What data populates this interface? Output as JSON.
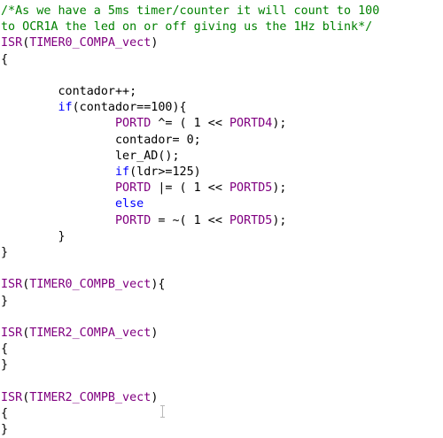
{
  "editor": {
    "colors": {
      "comment": "#008000",
      "macro": "#800080",
      "keyword": "#0000ff",
      "plain": "#000000",
      "background": "#ffffff"
    },
    "lines": [
      [
        {
          "t": "/*As we have a 5ms timer/counter it will count to 100",
          "c": "comment"
        }
      ],
      [
        {
          "t": "to OCR1A the led on or off giving us the 1Hz blink*/",
          "c": "comment"
        }
      ],
      [
        {
          "t": "ISR",
          "c": "macro"
        },
        {
          "t": "(",
          "c": "plain"
        },
        {
          "t": "TIMER0_COMPA_vect",
          "c": "macro"
        },
        {
          "t": ")",
          "c": "plain"
        }
      ],
      [
        {
          "t": "{",
          "c": "plain"
        }
      ],
      [
        {
          "t": "",
          "c": "plain"
        }
      ],
      [
        {
          "t": "        contador++;",
          "c": "plain"
        }
      ],
      [
        {
          "t": "        ",
          "c": "plain"
        },
        {
          "t": "if",
          "c": "keyword"
        },
        {
          "t": "(contador==100){",
          "c": "plain"
        }
      ],
      [
        {
          "t": "                ",
          "c": "plain"
        },
        {
          "t": "PORTD",
          "c": "macro"
        },
        {
          "t": " ^= ( 1 << ",
          "c": "plain"
        },
        {
          "t": "PORTD4",
          "c": "macro"
        },
        {
          "t": ");",
          "c": "plain"
        }
      ],
      [
        {
          "t": "                contador= 0;",
          "c": "plain"
        }
      ],
      [
        {
          "t": "                ler_AD();",
          "c": "plain"
        }
      ],
      [
        {
          "t": "                ",
          "c": "plain"
        },
        {
          "t": "if",
          "c": "keyword"
        },
        {
          "t": "(ldr>=125)",
          "c": "plain"
        }
      ],
      [
        {
          "t": "                ",
          "c": "plain"
        },
        {
          "t": "PORTD",
          "c": "macro"
        },
        {
          "t": " |= ( 1 << ",
          "c": "plain"
        },
        {
          "t": "PORTD5",
          "c": "macro"
        },
        {
          "t": ");",
          "c": "plain"
        }
      ],
      [
        {
          "t": "                ",
          "c": "plain"
        },
        {
          "t": "else",
          "c": "keyword"
        }
      ],
      [
        {
          "t": "                ",
          "c": "plain"
        },
        {
          "t": "PORTD",
          "c": "macro"
        },
        {
          "t": " = ~( 1 << ",
          "c": "plain"
        },
        {
          "t": "PORTD5",
          "c": "macro"
        },
        {
          "t": ");",
          "c": "plain"
        }
      ],
      [
        {
          "t": "        }",
          "c": "plain"
        }
      ],
      [
        {
          "t": "}",
          "c": "plain"
        }
      ],
      [
        {
          "t": "",
          "c": "plain"
        }
      ],
      [
        {
          "t": "ISR",
          "c": "macro"
        },
        {
          "t": "(",
          "c": "plain"
        },
        {
          "t": "TIMER0_COMPB_vect",
          "c": "macro"
        },
        {
          "t": "){",
          "c": "plain"
        }
      ],
      [
        {
          "t": "}",
          "c": "plain"
        }
      ],
      [
        {
          "t": "",
          "c": "plain"
        }
      ],
      [
        {
          "t": "ISR",
          "c": "macro"
        },
        {
          "t": "(",
          "c": "plain"
        },
        {
          "t": "TIMER2_COMPA_vect",
          "c": "macro"
        },
        {
          "t": ")",
          "c": "plain"
        }
      ],
      [
        {
          "t": "{",
          "c": "plain"
        }
      ],
      [
        {
          "t": "}",
          "c": "plain"
        }
      ],
      [
        {
          "t": "",
          "c": "plain"
        }
      ],
      [
        {
          "t": "ISR",
          "c": "macro"
        },
        {
          "t": "(",
          "c": "plain"
        },
        {
          "t": "TIMER2_COMPB_vect",
          "c": "macro"
        },
        {
          "t": ")",
          "c": "plain"
        }
      ],
      [
        {
          "t": "{",
          "c": "plain"
        }
      ],
      [
        {
          "t": "}",
          "c": "plain"
        }
      ]
    ]
  },
  "cursor": {
    "icon": "text-cursor-icon"
  }
}
